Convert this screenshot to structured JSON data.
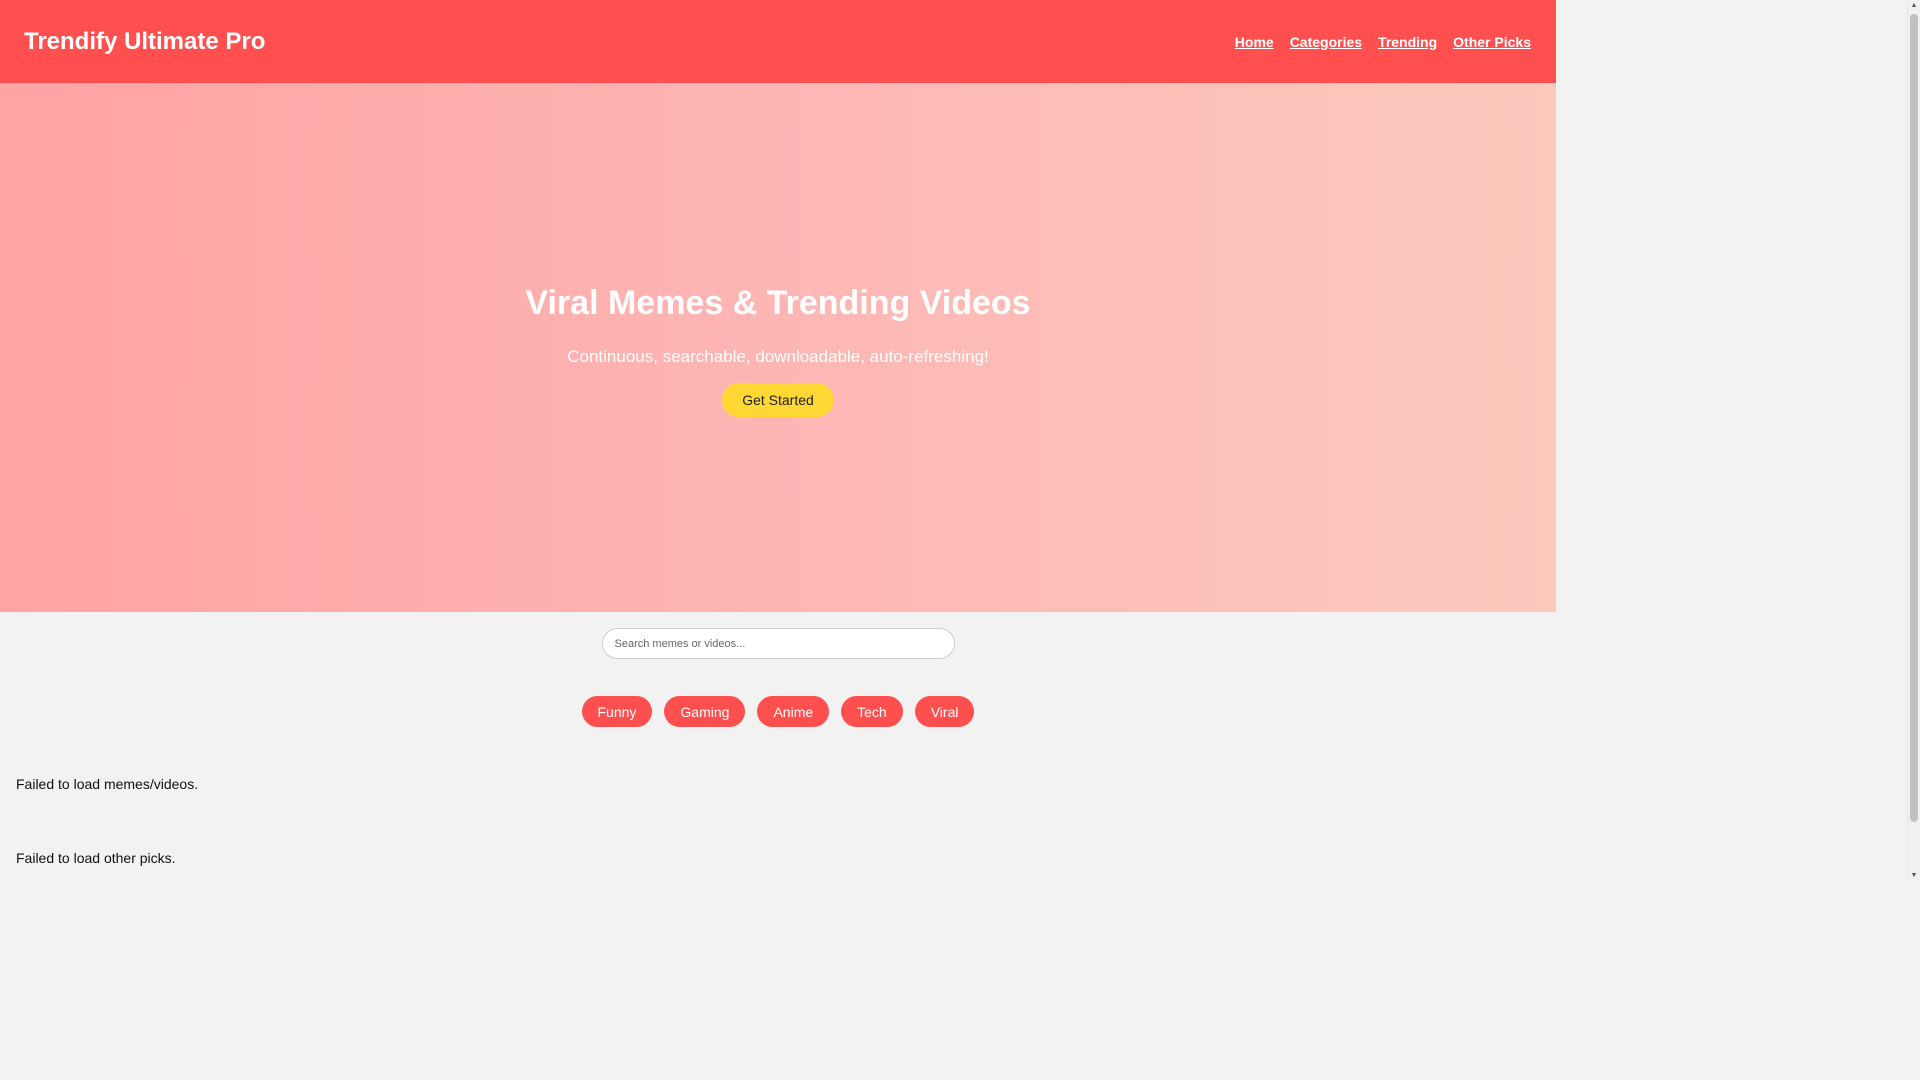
{
  "header": {
    "title": "Trendify Ultimate Pro",
    "nav": [
      {
        "label": "Home"
      },
      {
        "label": "Categories"
      },
      {
        "label": "Trending"
      },
      {
        "label": "Other Picks"
      }
    ]
  },
  "hero": {
    "title": "Viral Memes & Trending Videos",
    "subtitle": "Continuous, searchable, downloadable, auto-refreshing!",
    "cta_label": "Get Started"
  },
  "search": {
    "placeholder": "Search memes or videos...",
    "value": ""
  },
  "categories": [
    {
      "label": "Funny"
    },
    {
      "label": "Gaming"
    },
    {
      "label": "Anime"
    },
    {
      "label": "Tech"
    },
    {
      "label": "Viral"
    }
  ],
  "messages": {
    "memes_error": "Failed to load memes/videos.",
    "picks_error": "Failed to load other picks."
  },
  "scrollbar": {
    "up_icon": "▲",
    "down_icon": "▼"
  },
  "colors": {
    "brand": "#ff4f4f",
    "cta": "#fdd835",
    "background": "#f2f2f2"
  }
}
